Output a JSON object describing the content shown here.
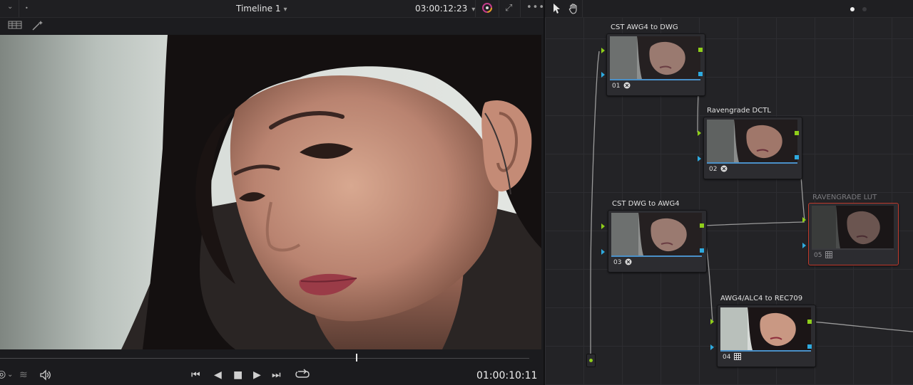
{
  "viewer": {
    "timeline_title": "Timeline 1",
    "source_timecode": "03:00:12:23",
    "record_timecode": "01:00:10:11",
    "icons": {
      "dropdown": "chevron-down-icon",
      "color_wheel": "color-picker-icon",
      "fullscreen": "fullscreen-icon",
      "more": "more-options-icon",
      "grid": "grid-display-icon",
      "magic": "magic-wand-icon"
    },
    "transport_icons": [
      "jump-to-start-icon",
      "step-back-icon",
      "stop-icon",
      "play-icon",
      "jump-to-end-icon",
      "loop-icon"
    ]
  },
  "node_editor": {
    "tools": [
      "pointer-icon",
      "hand-icon"
    ],
    "nodes": [
      {
        "id": "01",
        "label": "CST AWG4 to DWG",
        "icon": "ofx-icon",
        "selected": false
      },
      {
        "id": "02",
        "label": "Ravengrade DCTL",
        "icon": "ofx-icon",
        "selected": false
      },
      {
        "id": "03",
        "label": "CST DWG to AWG4",
        "icon": "ofx-icon",
        "selected": false
      },
      {
        "id": "04",
        "label": "AWG4/ALC4 to REC709",
        "icon": "lut-icon",
        "selected": false
      },
      {
        "id": "05",
        "label": "RAVENGRADE LUT",
        "icon": "lut-icon",
        "selected": true
      }
    ]
  },
  "colors": {
    "rgb_port": "#8fce1a",
    "alpha_port": "#2eaadf",
    "selected_border": "#c0392b"
  }
}
